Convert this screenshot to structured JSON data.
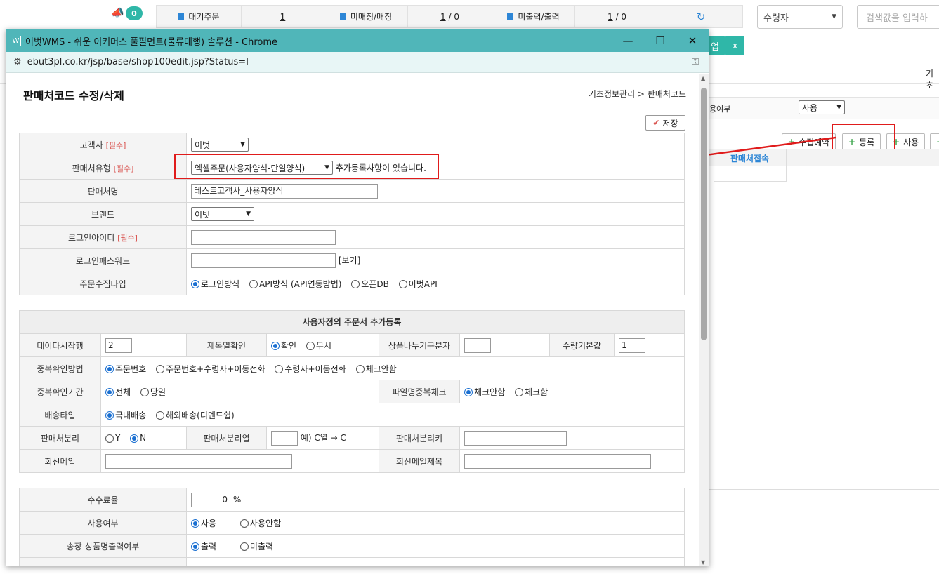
{
  "bg": {
    "notify_count": "0",
    "stats": [
      {
        "label": "대기주문",
        "value": "1"
      },
      {
        "label": "미매칭/매칭",
        "value": "1",
        "value2": "/ 0"
      },
      {
        "label": "미출력/출력",
        "value": "1",
        "value2": "/ 0"
      }
    ],
    "receiver_select": "수령자",
    "search_placeholder": "검색값을 입력하",
    "top_btn": "업",
    "close_x": "x",
    "right_text": "기초",
    "use_label": "용여부",
    "use_select": "사용",
    "buttons": {
      "collect": "수집예약",
      "register": "등록",
      "use": "사용"
    },
    "col_header": "판매처접속"
  },
  "popup": {
    "window_title": "이벗WMS - 쉬운 이커머스 풀필먼트(물류대행) 솔루션 - Chrome",
    "url": "ebut3pl.co.kr/jsp/base/shop100edit.jsp?Status=I",
    "page_title": "판매처코드 수정/삭제",
    "breadcrumb": "기초정보관리 > 판매처코드",
    "save_label": "저장",
    "required": "[필수]",
    "form": {
      "customer_label": "고객사",
      "customer_value": "이벗",
      "shoptype_label": "판매처유형",
      "shoptype_value": "엑셀주문(사용자양식-단일양식)",
      "shoptype_note": "추가등록사항이 있습니다.",
      "shopname_label": "판매처명",
      "shopname_value": "테스트고객사_사용자양식",
      "brand_label": "브랜드",
      "brand_value": "이벗",
      "loginid_label": "로그인아이디",
      "loginpw_label": "로그인패스워드",
      "view_label": "[보기]",
      "collect_label": "주문수집타입",
      "collect_opts": [
        "로그인방식",
        "API방식",
        "(API연동방법)",
        "오픈DB",
        "이벗API"
      ]
    },
    "custom": {
      "section_title": "사용자정의 주문서 추가등록",
      "data_start_label": "데이타시작행",
      "data_start_value": "2",
      "title_col_label": "제목열확인",
      "title_col_opts": [
        "확인",
        "무시"
      ],
      "split_label": "상품나누기구분자",
      "split_value": "",
      "qty_label": "수량기본값",
      "qty_value": "1",
      "dup_method_label": "중복확인방법",
      "dup_method_opts": [
        "주문번호",
        "주문번호+수령자+이동전화",
        "수령자+이동전화",
        "체크안함"
      ],
      "dup_period_label": "중복확인기간",
      "dup_period_opts": [
        "전체",
        "당일"
      ],
      "file_dup_label": "파일명중복체크",
      "file_dup_opts": [
        "체크안함",
        "체크함"
      ],
      "ship_label": "배송타입",
      "ship_opts": [
        "국내배송",
        "해외배송(디멘드쉽)"
      ],
      "sep_label": "판매처분리",
      "sep_opts": [
        "Y",
        "N"
      ],
      "sep_col_label": "판매처분리열",
      "sep_col_example": "예) C열 → C",
      "sep_key_label": "판매처분리키",
      "reply_mail_label": "회신메일",
      "reply_subject_label": "회신메일제목"
    },
    "extra": {
      "fee_label": "수수료율",
      "fee_value": "0",
      "fee_unit": "%",
      "use_label": "사용여부",
      "use_opts": [
        "사용",
        "사용안함"
      ],
      "invoice_label": "송장-상품명출력여부",
      "invoice_opts": [
        "출력",
        "미출력"
      ]
    }
  },
  "colors": {
    "accent": "#50b6b9",
    "radio": "#1a6fd1",
    "annotation": "#e01b1b"
  }
}
